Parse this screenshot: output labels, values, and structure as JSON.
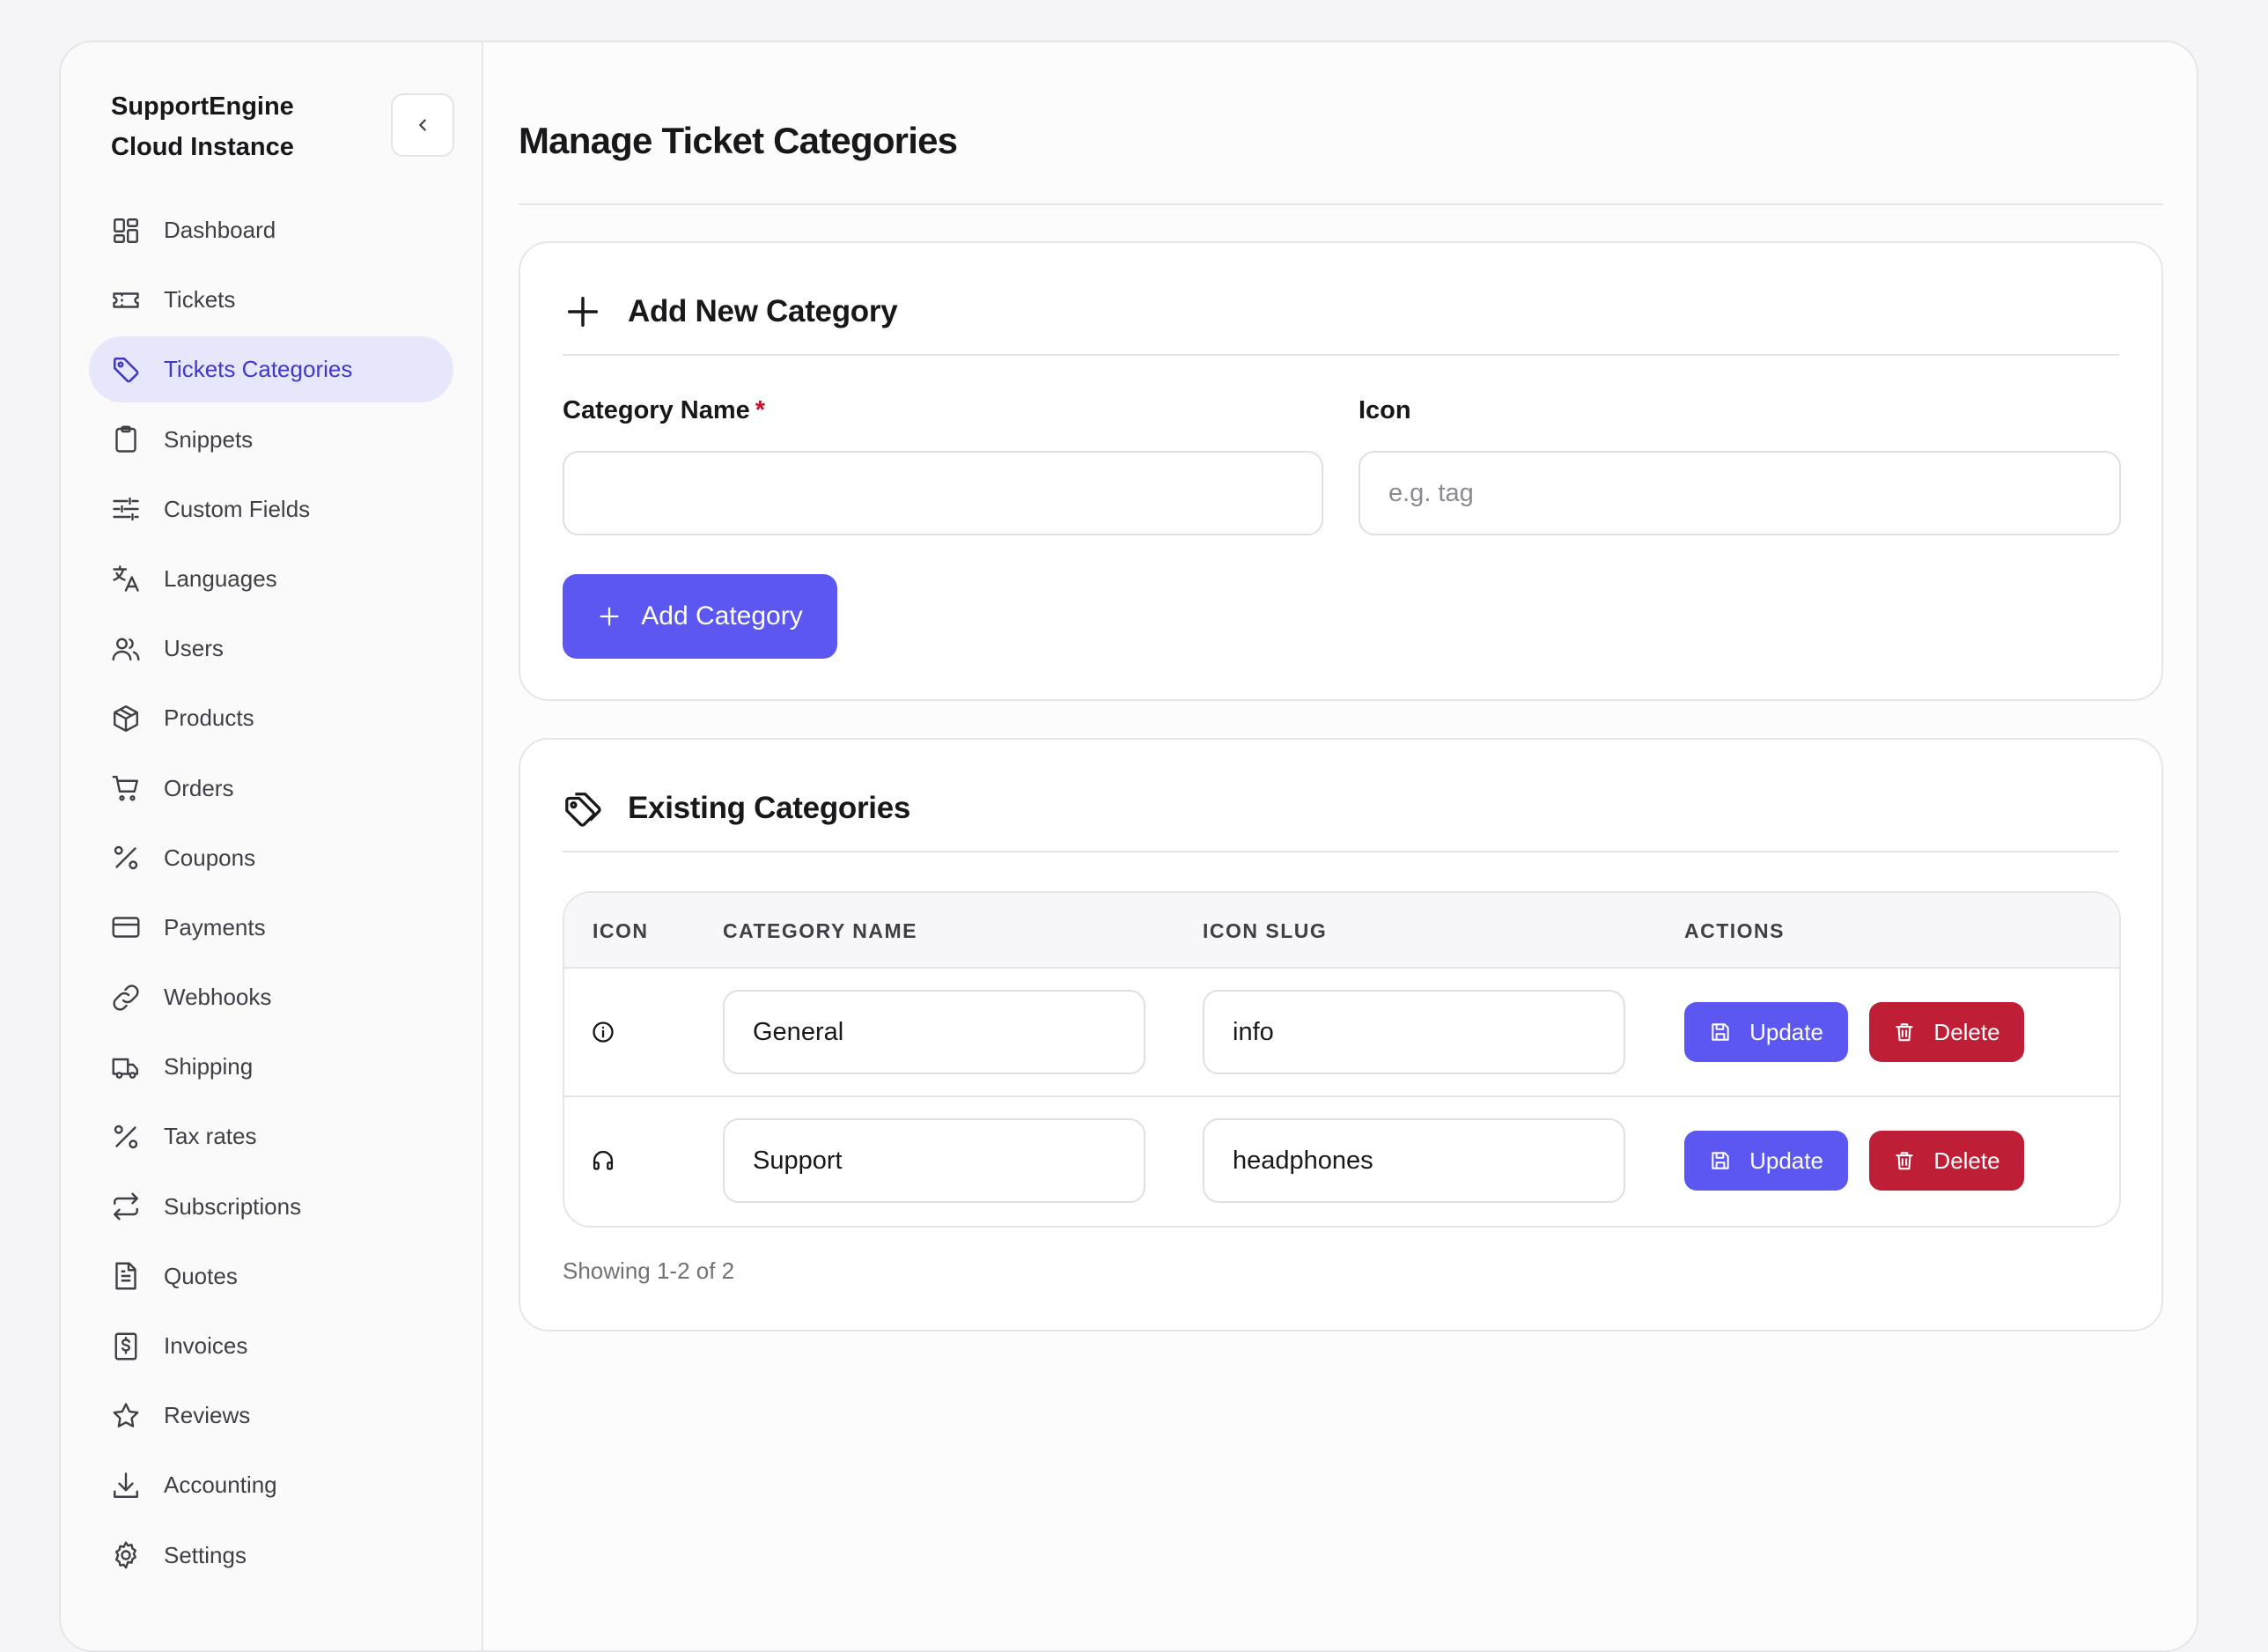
{
  "sidebar": {
    "brand": "SupportEngine Cloud Instance",
    "collapse_icon": "chevron-left-icon",
    "items": [
      {
        "label": "Dashboard",
        "icon": "dashboard-icon"
      },
      {
        "label": "Tickets",
        "icon": "ticket-icon"
      },
      {
        "label": "Tickets Categories",
        "icon": "tag-icon",
        "active": true
      },
      {
        "label": "Snippets",
        "icon": "clipboard-icon"
      },
      {
        "label": "Custom Fields",
        "icon": "sliders-icon"
      },
      {
        "label": "Languages",
        "icon": "translate-icon"
      },
      {
        "label": "Users",
        "icon": "users-icon"
      },
      {
        "label": "Products",
        "icon": "package-icon"
      },
      {
        "label": "Orders",
        "icon": "cart-icon"
      },
      {
        "label": "Coupons",
        "icon": "percent-icon"
      },
      {
        "label": "Payments",
        "icon": "credit-card-icon"
      },
      {
        "label": "Webhooks",
        "icon": "link-icon"
      },
      {
        "label": "Shipping",
        "icon": "truck-icon"
      },
      {
        "label": "Tax rates",
        "icon": "percent-icon"
      },
      {
        "label": "Subscriptions",
        "icon": "repeat-icon"
      },
      {
        "label": "Quotes",
        "icon": "file-text-icon"
      },
      {
        "label": "Invoices",
        "icon": "receipt-dollar-icon"
      },
      {
        "label": "Reviews",
        "icon": "star-icon"
      },
      {
        "label": "Accounting",
        "icon": "download-icon"
      },
      {
        "label": "Settings",
        "icon": "gear-icon"
      }
    ]
  },
  "page": {
    "title": "Manage Ticket Categories"
  },
  "add_card": {
    "title": "Add New Category",
    "icon": "plus-icon",
    "name_label": "Category Name",
    "required_mark": "*",
    "name_value": "",
    "icon_label": "Icon",
    "icon_placeholder": "e.g. tag",
    "icon_value": "",
    "submit_label": "Add Category"
  },
  "list_card": {
    "title": "Existing Categories",
    "icon": "tag-icon",
    "columns": [
      "ICON",
      "CATEGORY NAME",
      "ICON SLUG",
      "ACTIONS"
    ],
    "rows": [
      {
        "icon": "info-icon",
        "name": "General",
        "slug": "info",
        "update_label": "Update",
        "delete_label": "Delete"
      },
      {
        "icon": "headphones-icon",
        "name": "Support",
        "slug": "headphones",
        "update_label": "Update",
        "delete_label": "Delete"
      }
    ],
    "showing": "Showing 1-2 of 2"
  },
  "colors": {
    "accent": "#5b57f0",
    "danger": "#be1e36",
    "active_nav_bg": "#e6e7fb",
    "active_nav_text": "#4238c7"
  }
}
